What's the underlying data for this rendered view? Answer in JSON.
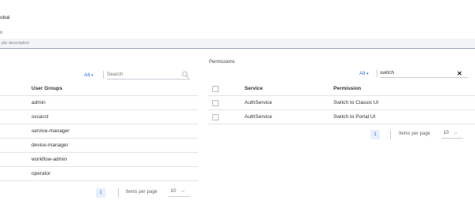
{
  "top": {
    "title": "obal",
    "name_label": "n",
    "description_placeholder": "ple description"
  },
  "left_panel": {
    "title": "",
    "filter": {
      "label": "All",
      "caret": "▾"
    },
    "search": {
      "placeholder": "Search",
      "icon": "search-icon"
    },
    "header": "User Groups",
    "rows": [
      "admin",
      "svcacct",
      "service-manager",
      "device-manager",
      "workflow-admin",
      "operator"
    ],
    "pagination": {
      "page": "1",
      "items_per_page_label": "Items per page",
      "per_page": "10"
    }
  },
  "right_panel": {
    "title": "Permissions",
    "filter": {
      "label": "All",
      "caret": "▾"
    },
    "search": {
      "value": "switch",
      "clear_icon": "close-icon",
      "clear_glyph": "✕"
    },
    "headers": {
      "service": "Service",
      "permission": "Permission"
    },
    "rows": [
      {
        "service": "AuthService",
        "permission": "Switch to Classic UI"
      },
      {
        "service": "AuthService",
        "permission": "Switch to Portal UI"
      }
    ],
    "pagination": {
      "page": "1",
      "items_per_page_label": "Items per page",
      "per_page": "10"
    }
  },
  "colors": {
    "accent": "#1f6feb",
    "border": "#e1e4e8",
    "field_bg": "#f3f4f6"
  }
}
